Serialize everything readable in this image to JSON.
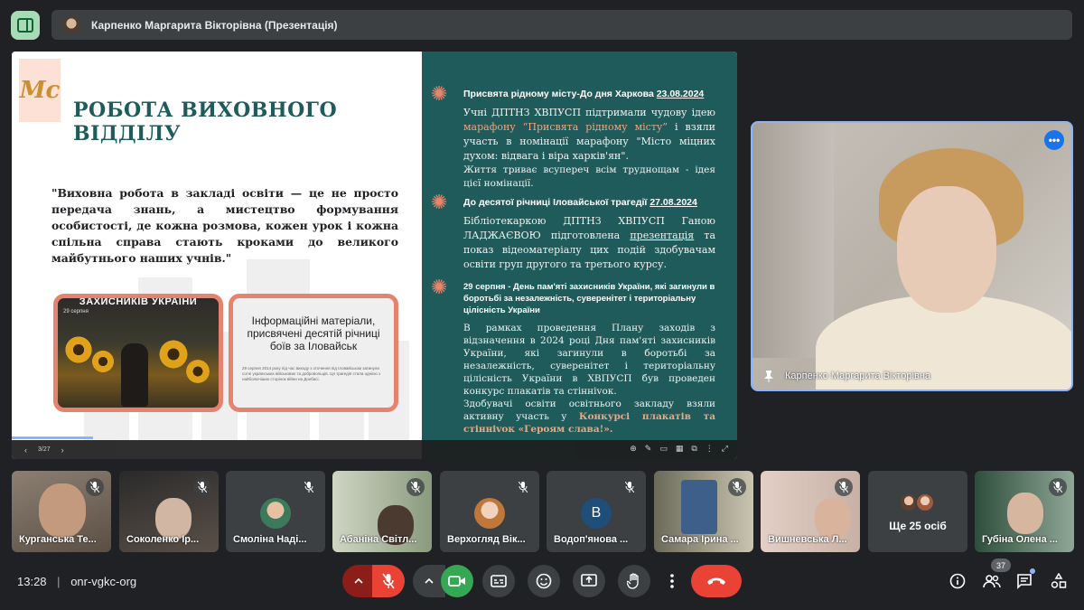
{
  "header": {
    "presenter_title": "Карпенко Маргарита Вікторівна (Презентація)"
  },
  "slide": {
    "logo_text": "Mc",
    "heading": "РОБОТА ВИХОВНОГО ВІДДІЛУ",
    "quote": "\"Виховна робота в закладі освіти — це не просто передача знань, а мистецтво формування особистості, де кожна розмова, кожен урок і кожна спільна справа стають кроками до великого майбутнього наших учнів.\"",
    "card1_title": "ЗАХИСНИКІВ УКРАЇНИ",
    "card1_date": "29 серпня",
    "card2_text": "Інформаційні матеріали, присвячені десятій річниці боїв за Іловайськ",
    "card2_small": "29 серпня 2014 року під час виходу з оточення під Іловайськом загинули сотні українських військових та добровольців. Ця трагедія стала однією з найболючіших сторінок війни на Донбасі.",
    "page_counter": "3/27",
    "sections": [
      {
        "title": "Присвята рідному місту-До дня Харкова",
        "date": "23.08.2024",
        "body_1": "Учні ДПТНЗ ХВПУСП підтримали чудову ідею ",
        "body_hl": "марафону “Присвята рідному місту”",
        "body_2": " і взяли участь в номінації марафону \"Місто міцних духом: відвага і віра харків'ян\".",
        "body_3": "Життя триває всупереч всім труднощам - ідея цієї номінації."
      },
      {
        "title": "До десятої річниці Іловайської трагедії",
        "date": "27.08.2024",
        "body_1": "Бібліотекаркою ДПТНЗ ХВПУСП Ганою ЛАДЖАЄВОЮ підготовлена ",
        "body_link": "презентація",
        "body_2": " та показ відеоматеріалу цих подій здобувачам освіти груп другого та третього курсу."
      },
      {
        "title": "29 серпня - День пам'яті захисників України, які загинули в боротьбі за незалежність, суверенітет і територіальну цілісність України",
        "body_1": "В рамках проведення Плану заходів з відзначення в 2024 році Дня пам'яті захисників України, які загинули в боротьбі за незалежність, суверенітет і територіальну цілісність України в ХВПУСП був проведен конкурс плакатів та стінніvок.",
        "body_2": "Здобувачі освіти освітнього закладу взяли активну участь у ",
        "body_hl": "Конкурсі плакатів та стінніvок «Героям слава!»."
      }
    ]
  },
  "self_view": {
    "name": "Карпенко Маргарита Вікторівна"
  },
  "participants": [
    {
      "name": "Курганська Те..."
    },
    {
      "name": "Соколенко Ір..."
    },
    {
      "name": "Смоліна Наді..."
    },
    {
      "name": "Абаніна Світл..."
    },
    {
      "name": "Верхогляд Вік..."
    },
    {
      "name": "Водоп'янова ...",
      "letter": "В"
    },
    {
      "name": "Самара Ірина ..."
    },
    {
      "name": "Вишневська Л..."
    },
    {
      "name": "Ще 25 осіб"
    },
    {
      "name": "Губіна Олена ..."
    }
  ],
  "footer": {
    "time": "13:28",
    "separator": "|",
    "meeting_code": "onr-vgkc-org",
    "participant_count": "37"
  },
  "colors": {
    "slide_teal": "#1e5b5a",
    "accent_orange": "#e8856c",
    "end_call_red": "#ea4335",
    "meet_green": "#34a853"
  }
}
